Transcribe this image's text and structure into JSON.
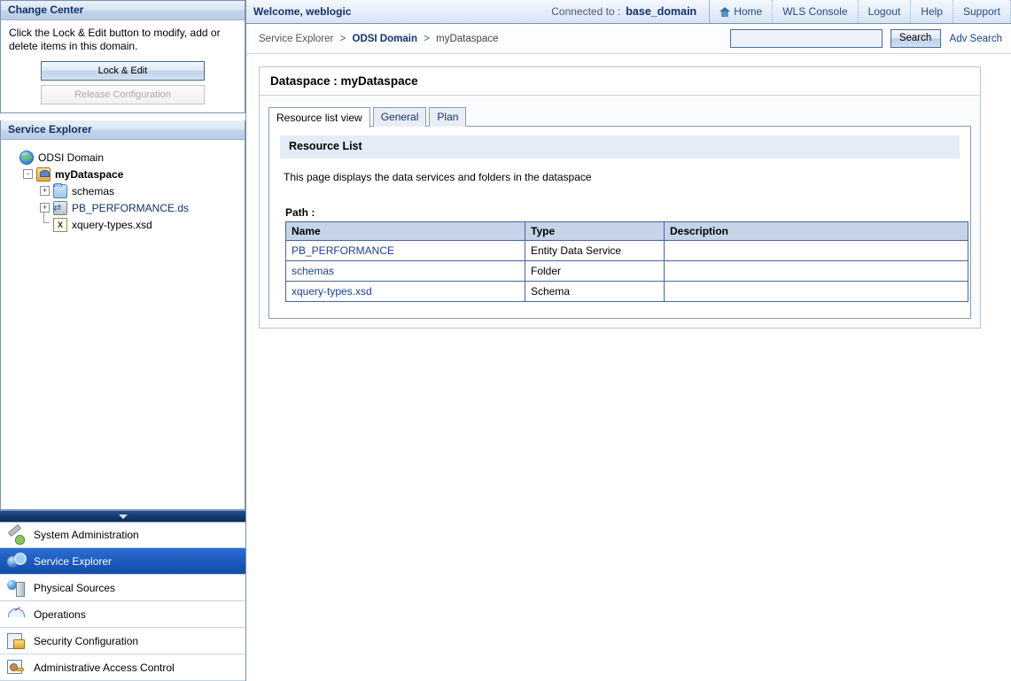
{
  "change_center": {
    "title": "Change Center",
    "instructions": "Click the Lock & Edit button to modify, add or delete items in this domain.",
    "lock_edit_label": "Lock & Edit",
    "release_config_label": "Release Configuration"
  },
  "service_explorer": {
    "title": "Service Explorer",
    "tree": [
      {
        "label": "ODSI Domain",
        "icon": "globe-icon",
        "expander": "",
        "indent": 0,
        "bold": false,
        "link": false
      },
      {
        "label": "myDataspace",
        "icon": "dataspace-icon",
        "expander": "-",
        "indent": 1,
        "bold": true,
        "link": false
      },
      {
        "label": "schemas",
        "icon": "folder-icon",
        "expander": "+",
        "indent": 2,
        "bold": false,
        "link": false
      },
      {
        "label": "PB_PERFORMANCE.ds",
        "icon": "data-service-icon",
        "expander": "+",
        "indent": 2,
        "bold": false,
        "link": true
      },
      {
        "label": "xquery-types.xsd",
        "icon": "schema-icon",
        "expander": "elbow",
        "indent": 2,
        "bold": false,
        "link": false
      }
    ]
  },
  "nav": {
    "items": [
      {
        "label": "System Administration",
        "icon": "system-administration-icon",
        "selected": false
      },
      {
        "label": "Service Explorer",
        "icon": "service-explorer-icon",
        "selected": true
      },
      {
        "label": "Physical Sources",
        "icon": "physical-sources-icon",
        "selected": false
      },
      {
        "label": "Operations",
        "icon": "operations-icon",
        "selected": false
      },
      {
        "label": "Security Configuration",
        "icon": "security-configuration-icon",
        "selected": false
      },
      {
        "label": "Administrative Access Control",
        "icon": "administrative-access-control-icon",
        "selected": false
      }
    ]
  },
  "topbar": {
    "welcome": "Welcome, weblogic",
    "connected_label": "Connected to :",
    "domain": "base_domain",
    "links": [
      {
        "label": "Home",
        "icon": "home-icon"
      },
      {
        "label": "WLS Console",
        "icon": ""
      },
      {
        "label": "Logout",
        "icon": ""
      },
      {
        "label": "Help",
        "icon": ""
      },
      {
        "label": "Support",
        "icon": ""
      }
    ]
  },
  "breadcrumb": {
    "item1": "Service Explorer",
    "sep": ">",
    "item2": "ODSI Domain",
    "item3": "myDataspace"
  },
  "search": {
    "value": "",
    "placeholder": "",
    "button_label": "Search",
    "adv_label": "Adv Search"
  },
  "main": {
    "page_title": "Dataspace : myDataspace",
    "tabs": [
      {
        "label": "Resource list view",
        "active": true
      },
      {
        "label": "General",
        "active": false
      },
      {
        "label": "Plan",
        "active": false
      }
    ],
    "resource_list": {
      "heading": "Resource List",
      "description": "This page displays the data services and folders in the dataspace",
      "path_label": "Path :",
      "columns": [
        "Name",
        "Type",
        "Description"
      ],
      "rows": [
        {
          "name": "PB_PERFORMANCE",
          "type": "Entity Data Service",
          "description": ""
        },
        {
          "name": "schemas",
          "type": "Folder",
          "description": ""
        },
        {
          "name": "xquery-types.xsd",
          "type": "Schema",
          "description": ""
        }
      ]
    }
  },
  "colors": {
    "accent_blue": "#16316e",
    "selection_blue": "#1d5bbd",
    "link_blue": "#1a3f95",
    "table_header": "#c5d4e8",
    "panel_header": "#e4ecf8"
  }
}
